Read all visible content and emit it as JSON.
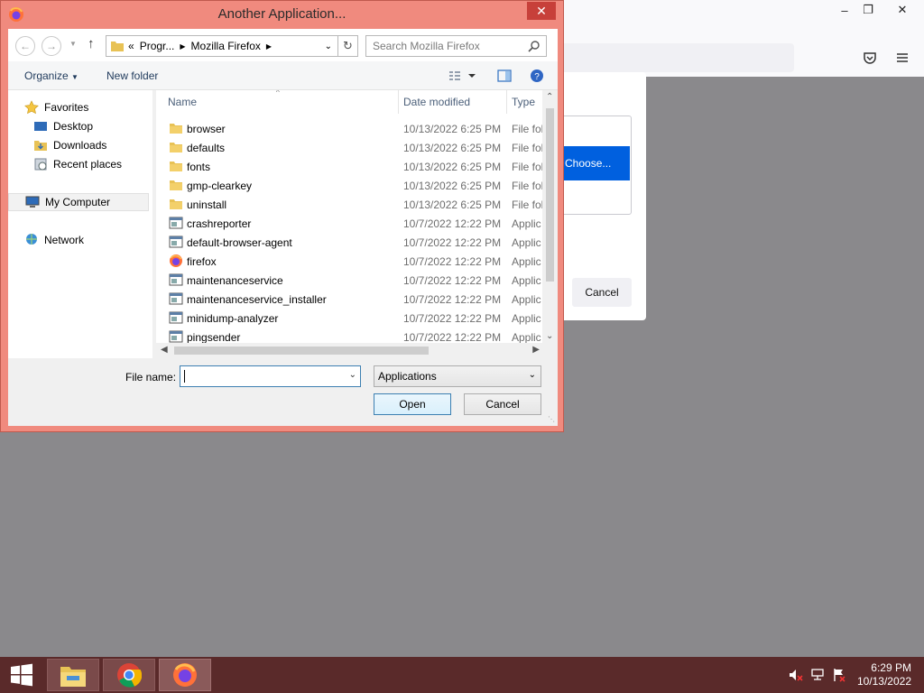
{
  "dialog": {
    "title": "Another Application...",
    "breadcrumb": {
      "prefix": "«",
      "segments": [
        "Progr...",
        "Mozilla Firefox"
      ]
    },
    "search_placeholder": "Search Mozilla Firefox",
    "toolbar": {
      "organize": "Organize",
      "new_folder": "New folder"
    },
    "nav": {
      "favorites": "Favorites",
      "desktop": "Desktop",
      "downloads": "Downloads",
      "recent": "Recent places",
      "computer": "My Computer",
      "network": "Network"
    },
    "columns": {
      "name": "Name",
      "date": "Date modified",
      "type": "Type"
    },
    "files": [
      {
        "name": "browser",
        "date": "10/13/2022 6:25 PM",
        "type": "File fol",
        "icon": "folder"
      },
      {
        "name": "defaults",
        "date": "10/13/2022 6:25 PM",
        "type": "File fol",
        "icon": "folder"
      },
      {
        "name": "fonts",
        "date": "10/13/2022 6:25 PM",
        "type": "File fol",
        "icon": "folder"
      },
      {
        "name": "gmp-clearkey",
        "date": "10/13/2022 6:25 PM",
        "type": "File fol",
        "icon": "folder"
      },
      {
        "name": "uninstall",
        "date": "10/13/2022 6:25 PM",
        "type": "File fol",
        "icon": "folder"
      },
      {
        "name": "crashreporter",
        "date": "10/7/2022 12:22 PM",
        "type": "Applic",
        "icon": "app"
      },
      {
        "name": "default-browser-agent",
        "date": "10/7/2022 12:22 PM",
        "type": "Applic",
        "icon": "app"
      },
      {
        "name": "firefox",
        "date": "10/7/2022 12:22 PM",
        "type": "Applic",
        "icon": "firefox"
      },
      {
        "name": "maintenanceservice",
        "date": "10/7/2022 12:22 PM",
        "type": "Applic",
        "icon": "app"
      },
      {
        "name": "maintenanceservice_installer",
        "date": "10/7/2022 12:22 PM",
        "type": "Applic",
        "icon": "app"
      },
      {
        "name": "minidump-analyzer",
        "date": "10/7/2022 12:22 PM",
        "type": "Applic",
        "icon": "app"
      },
      {
        "name": "pingsender",
        "date": "10/7/2022 12:22 PM",
        "type": "Applic",
        "icon": "app"
      }
    ],
    "filename_label": "File name:",
    "filename_value": "",
    "filetype": "Applications",
    "open": "Open",
    "cancel": "Cancel"
  },
  "background": {
    "choose": "Choose...",
    "cancel": "Cancel"
  },
  "taskbar": {
    "time": "6:29 PM",
    "date": "10/13/2022"
  },
  "colors": {
    "dialog_frame": "#f08a7e",
    "taskbar": "#5a2a2a",
    "accent": "#0060df"
  }
}
